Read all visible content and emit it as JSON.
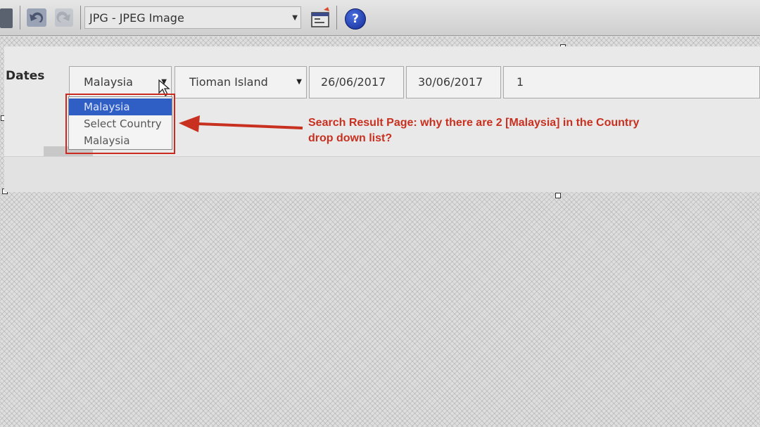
{
  "toolbar": {
    "format_value": "JPG - JPEG Image",
    "icons": [
      "document-icon",
      "undo-icon",
      "redo-icon",
      "properties-icon",
      "help-icon"
    ],
    "help_glyph": "?"
  },
  "search_form": {
    "dates_label": "Dates",
    "country_select": {
      "value": "Malaysia"
    },
    "destination_select": {
      "value": "Tioman Island"
    },
    "check_in": "26/06/2017",
    "check_out": "30/06/2017",
    "guests": "1"
  },
  "country_dropdown": {
    "options": [
      {
        "label": "Malaysia",
        "selected": true
      },
      {
        "label": "Select Country",
        "selected": false
      },
      {
        "label": "Malaysia",
        "selected": false
      }
    ]
  },
  "annotation": {
    "line1": "Search Result Page: why there are 2 [Malaysia] in the Country",
    "line2": "drop down list?",
    "color": "#c8301f"
  },
  "colors": {
    "selection": "#2f5fc4",
    "highlight_box": "#cc2a1e"
  }
}
